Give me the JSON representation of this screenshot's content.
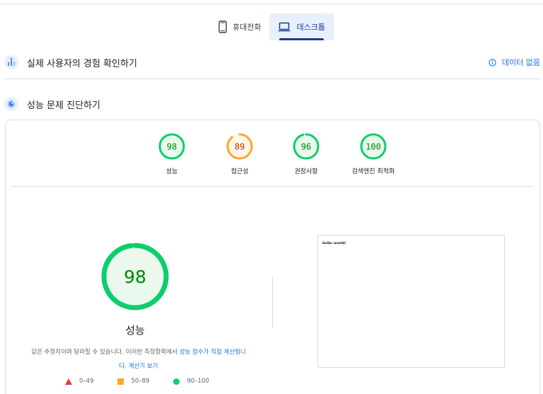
{
  "device_tabs": [
    {
      "label": "휴대전화",
      "icon": "mobile-phone-icon",
      "active": false
    },
    {
      "label": "데스크톱",
      "icon": "laptop-icon",
      "active": true
    }
  ],
  "field_data": {
    "title": "실제 사용자의 경험 확인하기",
    "status_label": "데이터 없음",
    "icon": "users-chart-icon",
    "status_icon": "info-icon"
  },
  "diagnostics": {
    "title": "성능 문제 진단하기",
    "icon": "lighthouse-icon"
  },
  "categories": [
    {
      "label": "성능",
      "score": "98",
      "value": 98,
      "status": "pass"
    },
    {
      "label": "접근성",
      "score": "89",
      "value": 89,
      "status": "average"
    },
    {
      "label": "권장사항",
      "score": "96",
      "value": 96,
      "status": "pass"
    },
    {
      "label": "검색엔진 최적화",
      "score": "100",
      "value": 100,
      "status": "pass"
    }
  ],
  "performance": {
    "score": "98",
    "value": 98,
    "label": "성능",
    "description_text": "값은 추정치이며 달라질 수 있습니다. 이러한 측정항목에서 ",
    "description_link": "성능 점수가 직접 계산됩니",
    "description_link2": "다.",
    "calculator_link": "계산기 보기"
  },
  "legend": [
    {
      "shape": "triangle",
      "range": "0–49",
      "color": "#e53935"
    },
    {
      "shape": "square",
      "range": "50–89",
      "color": "#fba730"
    },
    {
      "shape": "circle",
      "range": "90–100",
      "color": "#0cce6b"
    }
  ],
  "preview": {
    "text": "hello world!"
  },
  "colors": {
    "pass": "#0cce6b",
    "pass_text": "#008800",
    "pass_bg": "#eaf8ee",
    "average": "#fba730",
    "average_text": "#c33300",
    "average_bg": "#fff6ea",
    "accent": "#1a73e8",
    "active_tab": "#1a3d8f"
  }
}
